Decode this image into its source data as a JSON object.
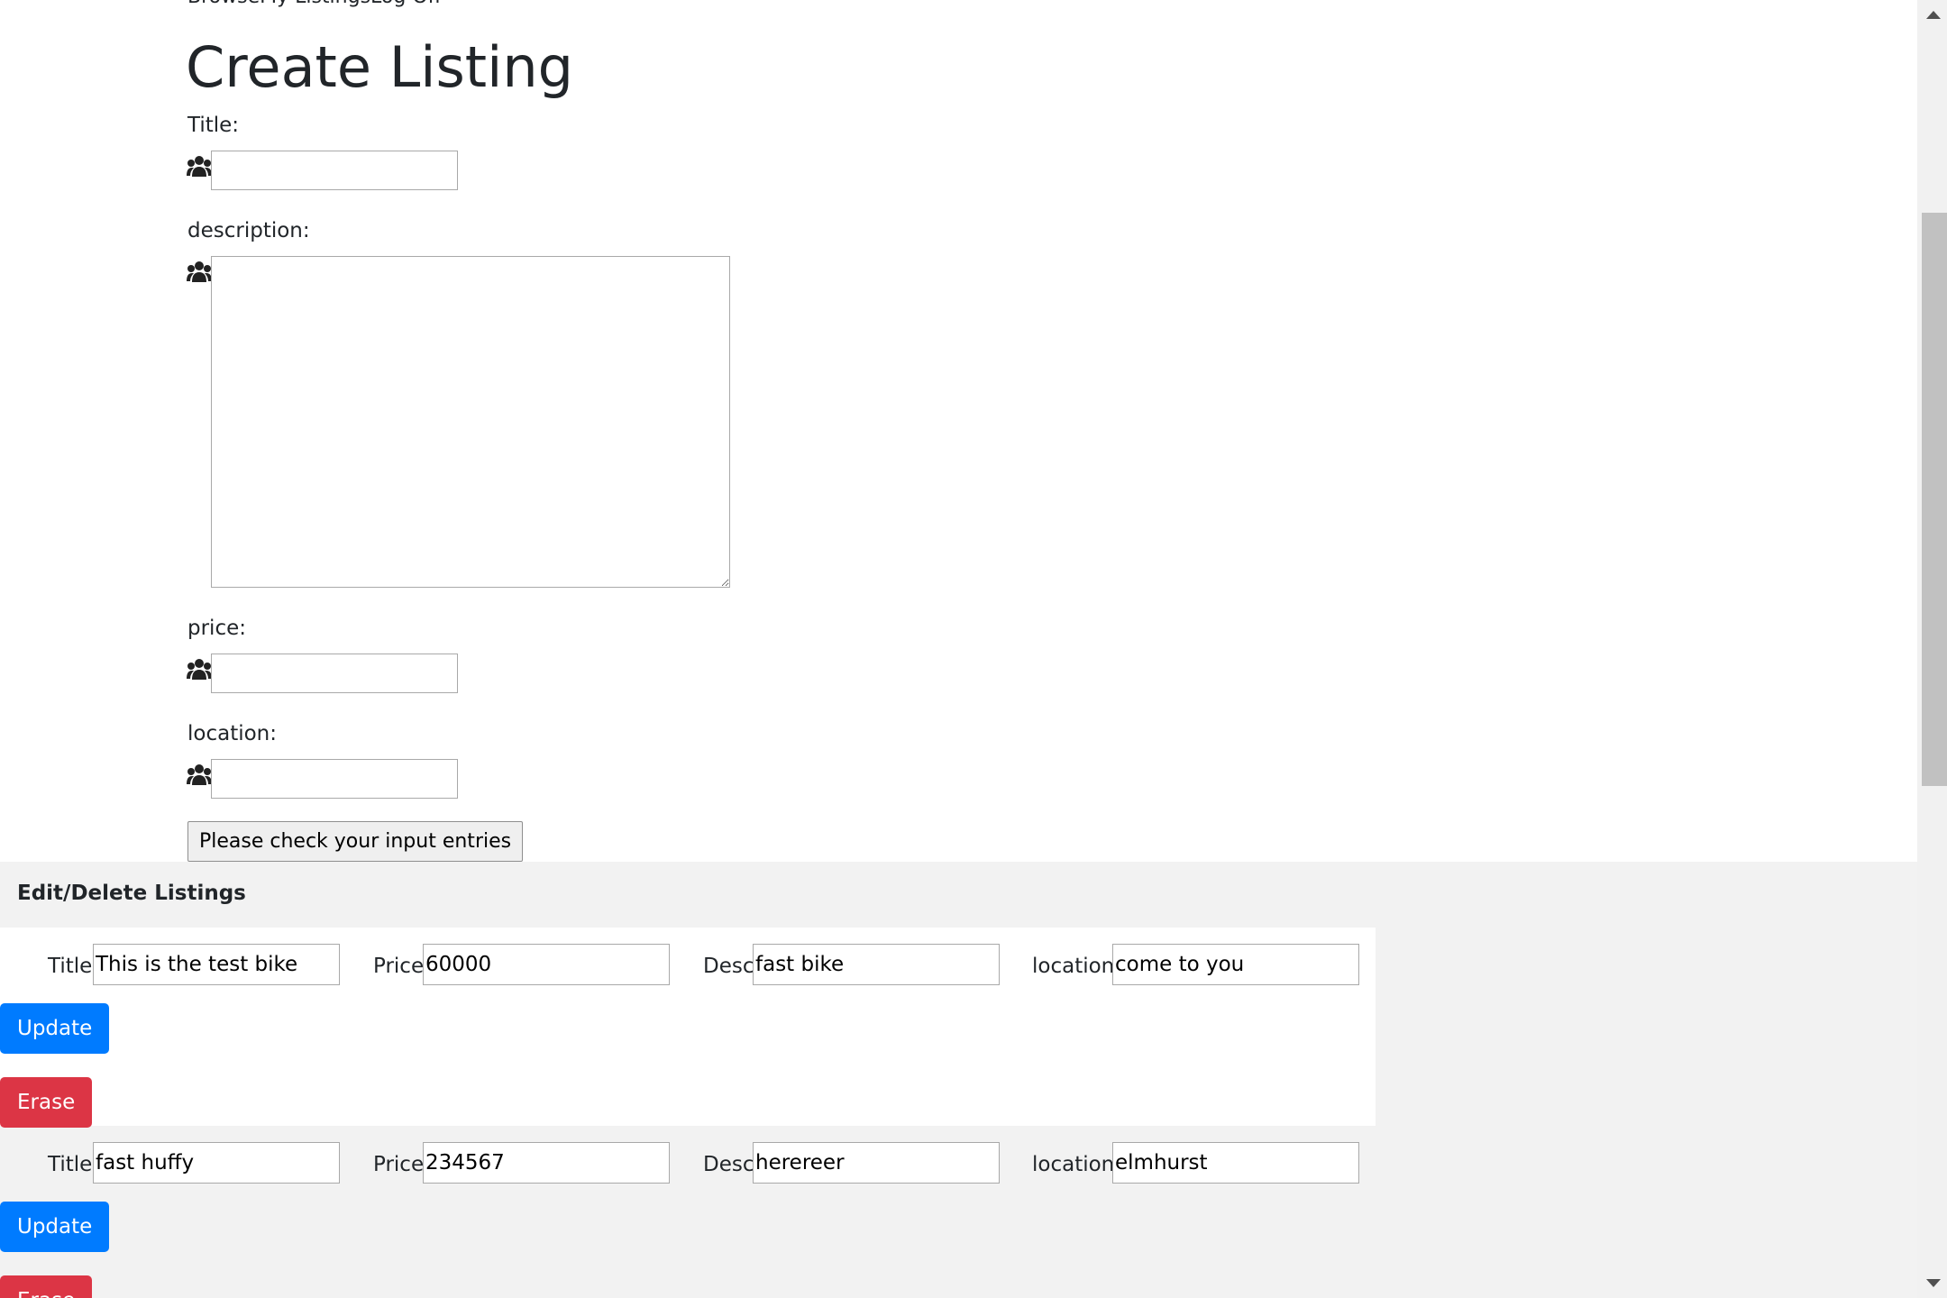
{
  "nav": {
    "links": "BrowseMy ListingsLog Off"
  },
  "create": {
    "heading": "Create Listing",
    "title_label": "Title:",
    "description_label": "description:",
    "price_label": "price:",
    "location_label": "location:",
    "title_value": "",
    "description_value": "",
    "price_value": "",
    "location_value": "",
    "submit_label": "Please check your input entries",
    "field_icon": "users-icon"
  },
  "edit": {
    "heading": "Edit/Delete Listings",
    "title_label": "Title:",
    "price_label": "Price:",
    "desc_label": "Desc:",
    "location_label": "location:",
    "update_label": "Update",
    "erase_label": "Erase",
    "listings": [
      {
        "title": "This is the test bike",
        "price": "60000",
        "desc": "fast bike",
        "location": "come to you"
      },
      {
        "title": "fast huffy",
        "price": "234567",
        "desc": "herereer",
        "location": "elmhurst"
      }
    ]
  },
  "colors": {
    "primary": "#007bff",
    "danger": "#dc3545",
    "section_bg": "#f2f2f2"
  }
}
